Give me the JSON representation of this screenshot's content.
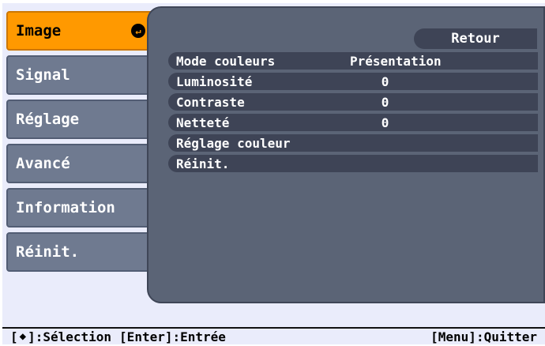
{
  "sidebar": {
    "items": [
      {
        "label": "Image",
        "active": true
      },
      {
        "label": "Signal"
      },
      {
        "label": "Réglage"
      },
      {
        "label": "Avancé"
      },
      {
        "label": "Information"
      },
      {
        "label": "Réinit."
      }
    ]
  },
  "panel": {
    "back_label": "Retour",
    "rows": [
      {
        "label": "Mode couleurs",
        "value": "Présentation"
      },
      {
        "label": "Luminosité",
        "value": "0"
      },
      {
        "label": "Contraste",
        "value": "0"
      },
      {
        "label": "Netteté",
        "value": "0"
      },
      {
        "label": "Réglage couleur",
        "value": ""
      },
      {
        "label": "Réinit.",
        "value": ""
      }
    ]
  },
  "statusbar": {
    "select_prefix": "[",
    "select_suffix": "]:Sélection",
    "enter_hint": "[Enter]:Entrée",
    "menu_hint": "[Menu]:Quitter"
  },
  "colors": {
    "accent": "#ff9900",
    "tab": "#6f7a90",
    "panel": "#5b6476",
    "row": "#3e4456",
    "background": "#eaecfb"
  },
  "icons": {
    "enter": "enter-icon",
    "updown": "updown-arrow-icon"
  }
}
